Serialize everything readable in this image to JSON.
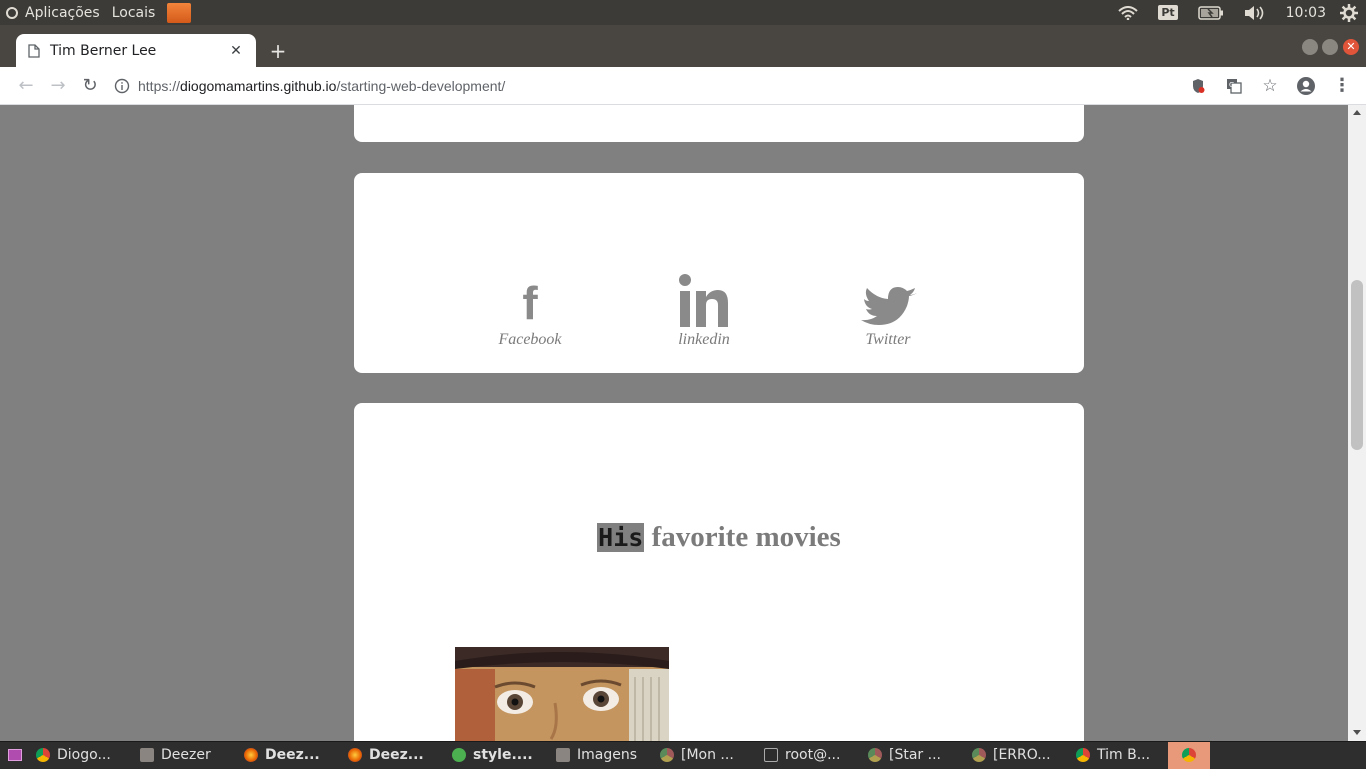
{
  "top_panel": {
    "applications_label": "Aplicações",
    "places_label": "Locais",
    "keyboard_layout": "Pt",
    "clock": "10:03"
  },
  "browser": {
    "tab_title": "Tim Berner Lee",
    "url_scheme": "https://",
    "url_host": "diogomamartins.github.io",
    "url_path": "/starting-web-development/"
  },
  "page": {
    "social": [
      {
        "label": "Facebook",
        "icon": "facebook-icon"
      },
      {
        "label": "linkedin",
        "icon": "linkedin-icon"
      },
      {
        "label": "Twitter",
        "icon": "twitter-icon"
      }
    ],
    "movies_title_highlight": "His",
    "movies_title_rest": " favorite movies"
  },
  "taskbar": {
    "items": [
      {
        "label": "Diogo...",
        "icon": "chrome-icon",
        "bold": false
      },
      {
        "label": "Deezer",
        "icon": "window-icon",
        "bold": false
      },
      {
        "label": "Deez...",
        "icon": "firefox-icon",
        "bold": true
      },
      {
        "label": "Deez...",
        "icon": "firefox-icon",
        "bold": true
      },
      {
        "label": "style....",
        "icon": "editor-icon",
        "bold": true
      },
      {
        "label": "Imagens",
        "icon": "window-icon",
        "bold": false
      },
      {
        "label": "[Mon ...",
        "icon": "chrome-icon",
        "bold": false
      },
      {
        "label": "root@...",
        "icon": "terminal-icon",
        "bold": false
      },
      {
        "label": "[Star ...",
        "icon": "chrome-icon",
        "bold": false
      },
      {
        "label": "[ERRO...",
        "icon": "chrome-icon",
        "bold": false
      },
      {
        "label": "Tim B...",
        "icon": "chrome-icon",
        "bold": false
      }
    ]
  }
}
